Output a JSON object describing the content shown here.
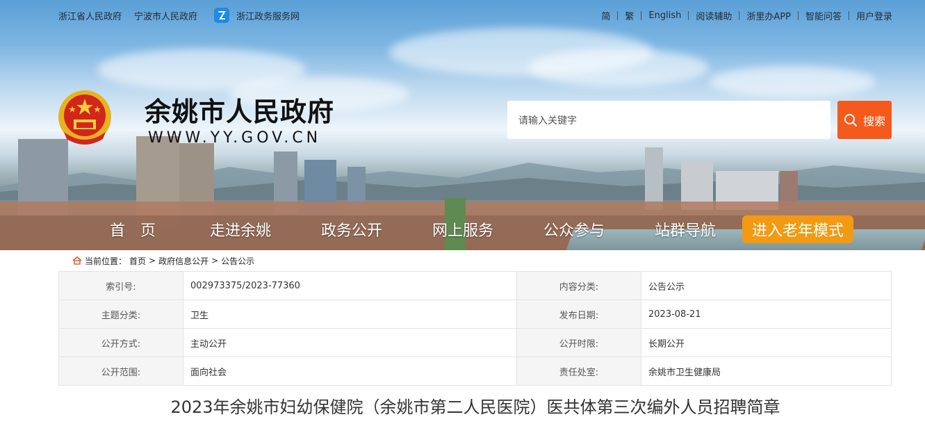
{
  "topbar": {
    "left_links": [
      "浙江省人民政府",
      "宁波市人民政府"
    ],
    "zj_service": "浙江政务服务网",
    "right_links": [
      "简",
      "繁",
      "English",
      "阅读辅助",
      "浙里办APP",
      "智能问答",
      "用户登录"
    ]
  },
  "header": {
    "title": "余姚市人民政府",
    "url": "WWW.YY.GOV.CN"
  },
  "search": {
    "placeholder": "请输入关键字",
    "button_label": "搜索"
  },
  "nav": {
    "items": [
      "首　页",
      "走进余姚",
      "政务公开",
      "网上服务",
      "公众参与",
      "站群导航"
    ],
    "elder_mode": "进入老年模式"
  },
  "breadcrumb": {
    "label": "当前位置：",
    "items": [
      "首页",
      "政府信息公开",
      "公告公示"
    ],
    "separator": ">"
  },
  "info": {
    "rows": [
      {
        "k1": "索引号:",
        "v1": "002973375/2023-77360",
        "k2": "内容分类:",
        "v2": "公告公示"
      },
      {
        "k1": "主题分类:",
        "v1": "卫生",
        "k2": "发布日期:",
        "v2": "2023-08-21"
      },
      {
        "k1": "公开方式:",
        "v1": "主动公开",
        "k2": "公开时限:",
        "v2": "长期公开"
      },
      {
        "k1": "公开范围:",
        "v1": "面向社会",
        "k2": "责任处室:",
        "v2": "余姚市卫生健康局"
      }
    ]
  },
  "article": {
    "title": "2023年余姚市妇幼保健院（余姚市第二人民医院）医共体第三次编外人员招聘简章"
  },
  "colors": {
    "search_button": "#f55a1d",
    "elder_button": "#f29a12",
    "table_key_bg": "#f5f5f5"
  }
}
